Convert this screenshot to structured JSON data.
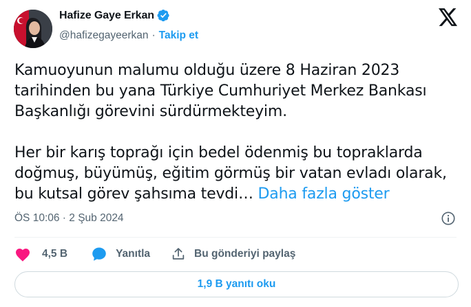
{
  "author": {
    "display_name": "Hafize Gaye Erkan",
    "handle": "@hafizegayeerkan",
    "separator": "·",
    "follow_label": "Takip et"
  },
  "tweet": {
    "paragraph_1": "Kamuoyunun malumu olduğu üzere 8 Haziran 2023 tarihinden bu yana Türkiye Cumhuriyet Merkez Bankası Başkanlığı görevini sürdürmekteyim.",
    "paragraph_2": "Her bir karış toprağı için bedel ödenmiş bu topraklarda doğmuş, büyümüş, eğitim görmüş bir vatan evladı olarak, bu kutsal görev şahsıma tevdi…",
    "show_more_label": "Daha fazla göster"
  },
  "meta": {
    "timestamp": "ÖS 10:06 · 2 Şub 2024"
  },
  "actions": {
    "like_count": "4,5 B",
    "reply_label": "Yanıtla",
    "share_label": "Bu gönderiyi paylaş"
  },
  "replies_button": {
    "label": "1,9 B yanıtı oku"
  },
  "colors": {
    "accent": "#1d9bf0",
    "like": "#f91880",
    "text": "#0f1419",
    "secondary": "#536471"
  }
}
